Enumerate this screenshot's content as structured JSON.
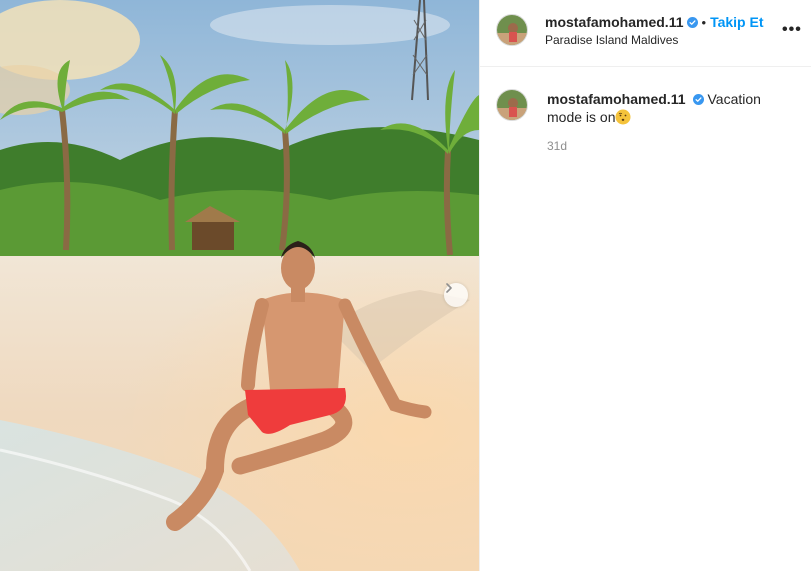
{
  "post": {
    "author": "mostafamohamed.11",
    "location": "Paradise Island Maldives",
    "follow_label": "Takip Et",
    "separator": "•",
    "more_label": "•••",
    "caption_text": "Vacation mode is on",
    "caption_emoji": "shushing-face-emoji",
    "timestamp": "31d"
  },
  "icons": {
    "verified": "verified-badge-icon",
    "next": "chevron-right-icon",
    "more": "more-options-icon"
  },
  "colors": {
    "link": "#0095f6",
    "verified": "#3897f0",
    "muted": "#8e8e8e",
    "text": "#262626"
  }
}
